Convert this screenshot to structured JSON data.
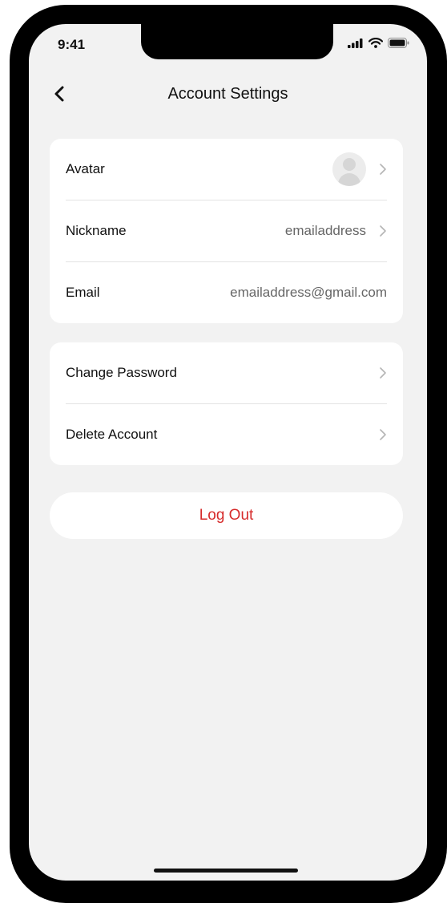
{
  "status_bar": {
    "time": "9:41"
  },
  "nav": {
    "title": "Account Settings"
  },
  "profile_section": {
    "avatar_label": "Avatar",
    "nickname_label": "Nickname",
    "nickname_value": "emailaddress",
    "email_label": "Email",
    "email_value": "emailaddress@gmail.com"
  },
  "security_section": {
    "change_password_label": "Change Password",
    "delete_account_label": "Delete Account"
  },
  "logout": {
    "label": "Log Out"
  },
  "colors": {
    "accent_red": "#d62b2b",
    "background": "#f2f2f2"
  }
}
